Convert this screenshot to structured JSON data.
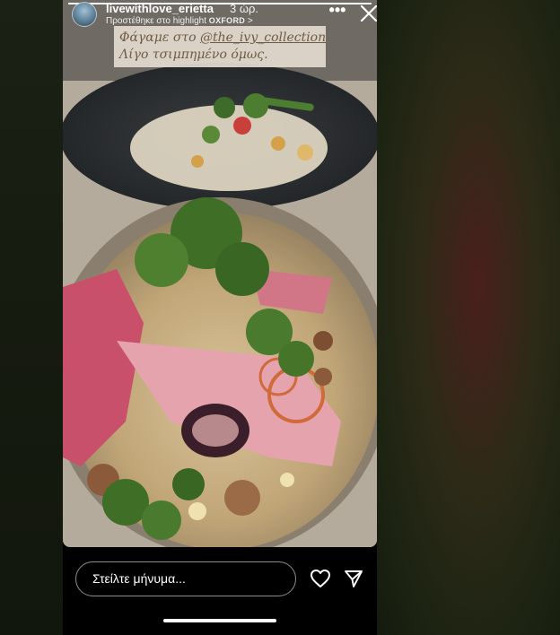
{
  "story": {
    "progress": 1.0,
    "username": "livewithlove_erietta",
    "time": "3 ώρ.",
    "highlight_prefix": "Προστέθηκε στο highlight",
    "highlight_name": "OXFORD",
    "chevron": ">",
    "more_glyph": "•••",
    "caption_line1_prefix": "Φάγαμε στο ",
    "caption_mention": "@the_ivy_collection",
    "caption_line2": "Λίγο τσιμπημένο όμως.",
    "photo_subject": "plated salad with beetroot, figs, herbs and nuts",
    "reply_placeholder": "Στείλτε μήνυμα...",
    "icons": [
      "more-icon",
      "close-icon",
      "heart-icon",
      "send-icon",
      "avatar"
    ]
  },
  "colors": {
    "caption_bg": "#e2dacd",
    "caption_text": "#6e5b45",
    "plate_dark": "#2c2f31",
    "plate_front": "#b79d74",
    "beet": "#c9506b"
  }
}
